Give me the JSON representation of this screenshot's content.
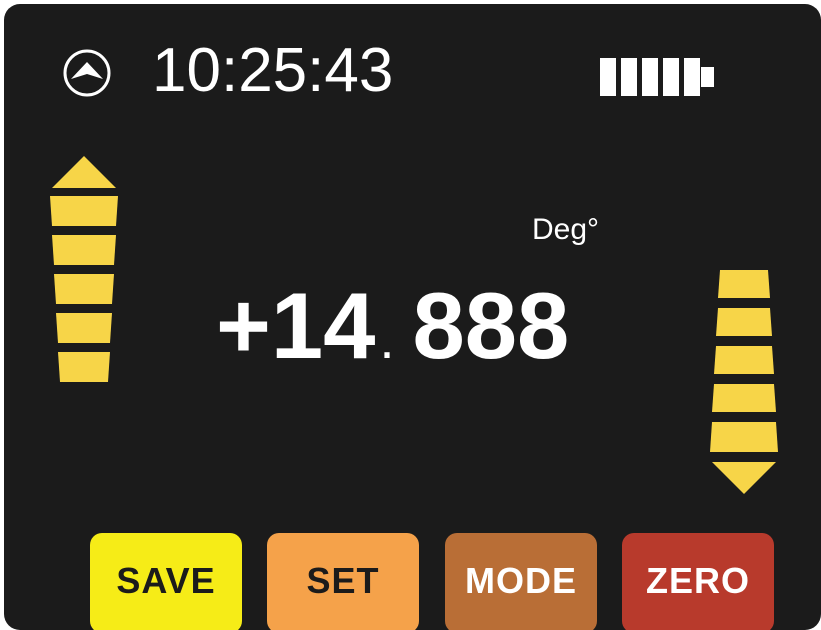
{
  "status": {
    "time": "10:25:43",
    "nav_icon": "navigation-arrow-icon",
    "battery_icon": "battery-icon",
    "battery_level": 0.8
  },
  "indicators": {
    "left": {
      "direction": "up",
      "segments": 5
    },
    "right": {
      "direction": "down",
      "segments": 5
    },
    "color": "#f7d548"
  },
  "measurement": {
    "unit": "Deg°",
    "integer_part": "+14",
    "decimal_separator": ".",
    "fraction_part": "888"
  },
  "buttons": {
    "save": "SAVE",
    "set": "SET",
    "mode": "MODE",
    "zero": "ZERO"
  },
  "colors": {
    "background": "#1b1b1b",
    "save": "#f6ec17",
    "set": "#f5a24a",
    "mode": "#b96e36",
    "zero": "#b83a2c"
  }
}
